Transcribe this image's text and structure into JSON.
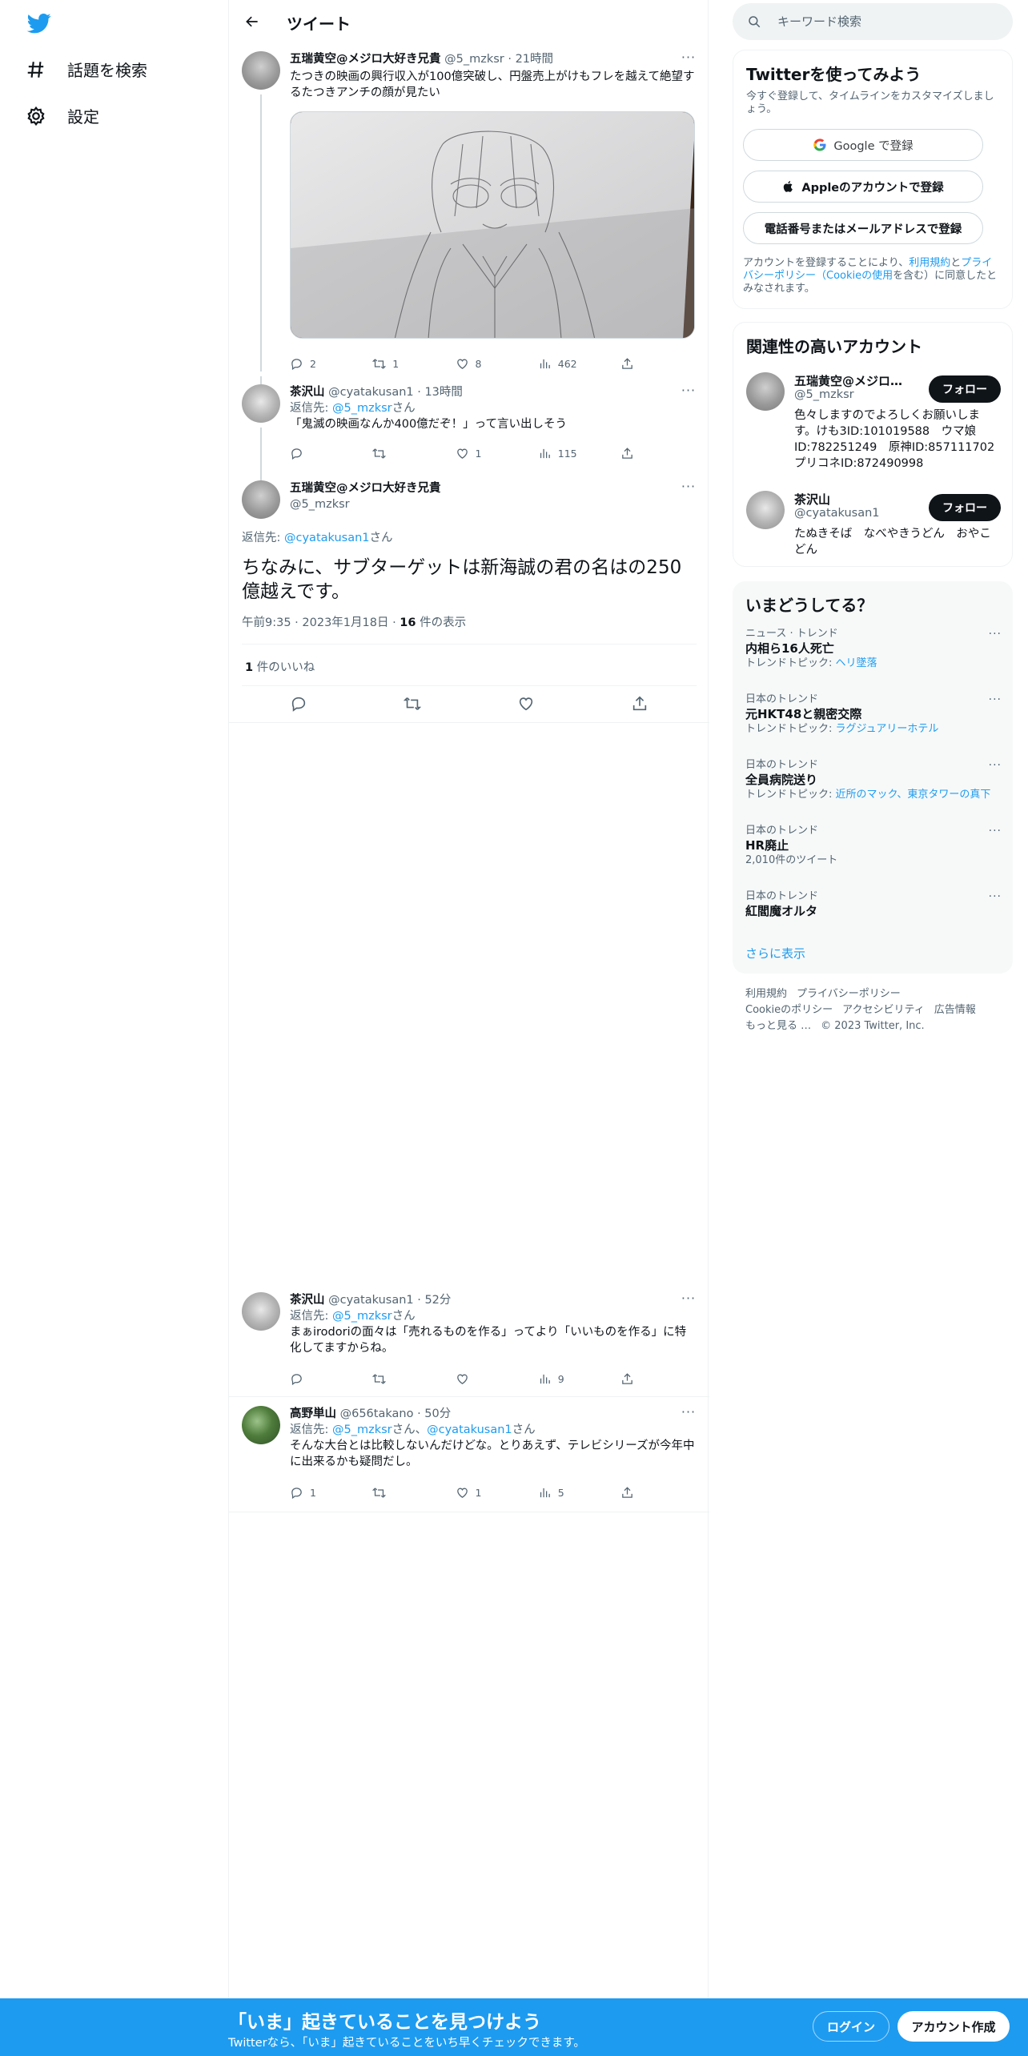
{
  "colors": {
    "accent": "#1d9bf0",
    "text": "#0f1419",
    "muted": "#536471",
    "bottom_bar": "#1d9bf0"
  },
  "nav": {
    "explore_label": "話題を検索",
    "settings_label": "設定"
  },
  "header": {
    "title": "ツイート"
  },
  "tweets": {
    "parent": {
      "name": "五瑞黄空@メジロ大好き兄貴",
      "handle": "@5_mzksr",
      "time": "21時間",
      "text": "たつきの映画の興行収入が100億突破し、円盤売上がけもフレを越えて絶望するたつきアンチの顔が見たい",
      "replies": "2",
      "retweets": "1",
      "likes": "8",
      "views": "462"
    },
    "reply1": {
      "name": "茶沢山",
      "handle": "@cyatakusan1",
      "time": "13時間",
      "reply_prefix": "返信先: ",
      "reply_to": "@5_mzksr",
      "reply_suffix": "さん",
      "text": "「鬼滅の映画なんか400億だぞ！」って言い出しそう",
      "replies": "",
      "retweets": "",
      "likes": "1",
      "views": "115"
    },
    "focus": {
      "name": "五瑞黄空@メジロ大好き兄貴",
      "handle": "@5_mzksr",
      "reply_prefix": "返信先: ",
      "reply_to": "@cyatakusan1",
      "reply_suffix": "さん",
      "text": "ちなみに、サブターゲットは新海誠の君の名はの250億越えです。",
      "time": "午前9:35",
      "date": "2023年1月18日",
      "views_count": "16",
      "views_label": " 件の表示",
      "likes_count": "1",
      "likes_label": " 件のいいね"
    },
    "reply2": {
      "name": "茶沢山",
      "handle": "@cyatakusan1",
      "time": "52分",
      "reply_prefix": "返信先: ",
      "reply_to": "@5_mzksr",
      "reply_suffix": "さん",
      "text": "まぁirodoriの面々は「売れるものを作る」ってより「いいものを作る」に特化してますからね。",
      "replies": "",
      "retweets": "",
      "likes": "",
      "views": "9"
    },
    "reply3": {
      "name": "高野単山",
      "handle": "@656takano",
      "time": "50分",
      "reply_prefix": "返信先: ",
      "reply_to": "@5_mzksr",
      "reply_mid": "さん、",
      "reply_to2": "@cyatakusan1",
      "reply_suffix": "さん",
      "text": "そんな大台とは比較しないんだけどな。とりあえず、テレビシリーズが今年中に出来るかも疑問だし。",
      "replies": "1",
      "retweets": "",
      "likes": "1",
      "views": "5"
    }
  },
  "sidebar": {
    "search_placeholder": "キーワード検索",
    "signup": {
      "title": "Twitterを使ってみよう",
      "subtitle": "今すぐ登録して、タイムラインをカスタマイズしましょう。",
      "google_label": "Google で登録",
      "apple_label": "Appleのアカウントで登録",
      "phone_label": "電話番号またはメールアドレスで登録",
      "terms_pre": "アカウントを登録することにより、",
      "terms_link": "利用規約",
      "terms_and": "と",
      "privacy_link": "プライバシーポリシー（Cookieの使用",
      "terms_post": "を含む）に同意したとみなされます。"
    },
    "relevant": {
      "title": "関連性の高いアカウント",
      "follow_label": "フォロー",
      "accounts": [
        {
          "name": "五瑞黄空@メジロ大好き兄貴",
          "handle": "@5_mzksr",
          "bio": "色々しますのでよろしくお願いします。けも3ID:101019588　ウマ娘ID:782251249　原神ID:857111702　プリコネID:872490998"
        },
        {
          "name": "茶沢山",
          "handle": "@cyatakusan1",
          "bio": "たぬきそば　なべやきうどん　おやこどん"
        }
      ]
    },
    "trends": {
      "title": "いまどうしてる？",
      "items": [
        {
          "category": "ニュース · トレンド",
          "title": "内相ら16人死亡",
          "sub_label": "トレンドトピック: ",
          "sub_link": "ヘリ墜落"
        },
        {
          "category": "日本のトレンド",
          "title": "元HKT48と親密交際",
          "sub_label": "トレンドトピック: ",
          "sub_link": "ラグジュアリーホテル"
        },
        {
          "category": "日本のトレンド",
          "title": "全員病院送り",
          "sub_label": "トレンドトピック: ",
          "sub_link": "近所のマック、東京タワーの真下"
        },
        {
          "category": "日本のトレンド",
          "title": "HR廃止",
          "sub_label": "2,010件のツイート",
          "sub_link": ""
        },
        {
          "category": "日本のトレンド",
          "title": "紅閻魔オルタ",
          "sub_label": "",
          "sub_link": ""
        }
      ],
      "show_more": "さらに表示"
    },
    "footer": {
      "links": [
        "利用規約",
        "プライバシーポリシー",
        "Cookieのポリシー",
        "アクセシビリティ",
        "広告情報",
        "もっと見る …"
      ],
      "copyright": "© 2023 Twitter, Inc."
    }
  },
  "bottom_bar": {
    "title": "「いま」起きていることを見つけよう",
    "subtitle": "Twitterなら、「いま」起きていることをいち早くチェックできます。",
    "login_label": "ログイン",
    "signup_label": "アカウント作成"
  }
}
